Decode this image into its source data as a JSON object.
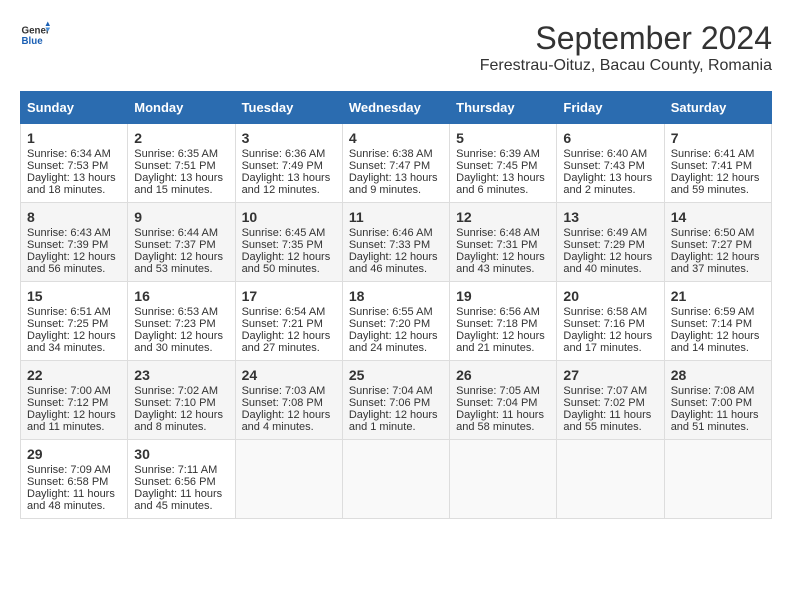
{
  "header": {
    "logo_general": "General",
    "logo_blue": "Blue",
    "month_title": "September 2024",
    "location": "Ferestrau-Oituz, Bacau County, Romania"
  },
  "columns": [
    "Sunday",
    "Monday",
    "Tuesday",
    "Wednesday",
    "Thursday",
    "Friday",
    "Saturday"
  ],
  "weeks": [
    [
      {
        "day": "1",
        "sunrise": "6:34 AM",
        "sunset": "7:53 PM",
        "daylight": "13 hours and 18 minutes."
      },
      {
        "day": "2",
        "sunrise": "6:35 AM",
        "sunset": "7:51 PM",
        "daylight": "13 hours and 15 minutes."
      },
      {
        "day": "3",
        "sunrise": "6:36 AM",
        "sunset": "7:49 PM",
        "daylight": "13 hours and 12 minutes."
      },
      {
        "day": "4",
        "sunrise": "6:38 AM",
        "sunset": "7:47 PM",
        "daylight": "13 hours and 9 minutes."
      },
      {
        "day": "5",
        "sunrise": "6:39 AM",
        "sunset": "7:45 PM",
        "daylight": "13 hours and 6 minutes."
      },
      {
        "day": "6",
        "sunrise": "6:40 AM",
        "sunset": "7:43 PM",
        "daylight": "13 hours and 2 minutes."
      },
      {
        "day": "7",
        "sunrise": "6:41 AM",
        "sunset": "7:41 PM",
        "daylight": "12 hours and 59 minutes."
      }
    ],
    [
      {
        "day": "8",
        "sunrise": "6:43 AM",
        "sunset": "7:39 PM",
        "daylight": "12 hours and 56 minutes."
      },
      {
        "day": "9",
        "sunrise": "6:44 AM",
        "sunset": "7:37 PM",
        "daylight": "12 hours and 53 minutes."
      },
      {
        "day": "10",
        "sunrise": "6:45 AM",
        "sunset": "7:35 PM",
        "daylight": "12 hours and 50 minutes."
      },
      {
        "day": "11",
        "sunrise": "6:46 AM",
        "sunset": "7:33 PM",
        "daylight": "12 hours and 46 minutes."
      },
      {
        "day": "12",
        "sunrise": "6:48 AM",
        "sunset": "7:31 PM",
        "daylight": "12 hours and 43 minutes."
      },
      {
        "day": "13",
        "sunrise": "6:49 AM",
        "sunset": "7:29 PM",
        "daylight": "12 hours and 40 minutes."
      },
      {
        "day": "14",
        "sunrise": "6:50 AM",
        "sunset": "7:27 PM",
        "daylight": "12 hours and 37 minutes."
      }
    ],
    [
      {
        "day": "15",
        "sunrise": "6:51 AM",
        "sunset": "7:25 PM",
        "daylight": "12 hours and 34 minutes."
      },
      {
        "day": "16",
        "sunrise": "6:53 AM",
        "sunset": "7:23 PM",
        "daylight": "12 hours and 30 minutes."
      },
      {
        "day": "17",
        "sunrise": "6:54 AM",
        "sunset": "7:21 PM",
        "daylight": "12 hours and 27 minutes."
      },
      {
        "day": "18",
        "sunrise": "6:55 AM",
        "sunset": "7:20 PM",
        "daylight": "12 hours and 24 minutes."
      },
      {
        "day": "19",
        "sunrise": "6:56 AM",
        "sunset": "7:18 PM",
        "daylight": "12 hours and 21 minutes."
      },
      {
        "day": "20",
        "sunrise": "6:58 AM",
        "sunset": "7:16 PM",
        "daylight": "12 hours and 17 minutes."
      },
      {
        "day": "21",
        "sunrise": "6:59 AM",
        "sunset": "7:14 PM",
        "daylight": "12 hours and 14 minutes."
      }
    ],
    [
      {
        "day": "22",
        "sunrise": "7:00 AM",
        "sunset": "7:12 PM",
        "daylight": "12 hours and 11 minutes."
      },
      {
        "day": "23",
        "sunrise": "7:02 AM",
        "sunset": "7:10 PM",
        "daylight": "12 hours and 8 minutes."
      },
      {
        "day": "24",
        "sunrise": "7:03 AM",
        "sunset": "7:08 PM",
        "daylight": "12 hours and 4 minutes."
      },
      {
        "day": "25",
        "sunrise": "7:04 AM",
        "sunset": "7:06 PM",
        "daylight": "12 hours and 1 minute."
      },
      {
        "day": "26",
        "sunrise": "7:05 AM",
        "sunset": "7:04 PM",
        "daylight": "11 hours and 58 minutes."
      },
      {
        "day": "27",
        "sunrise": "7:07 AM",
        "sunset": "7:02 PM",
        "daylight": "11 hours and 55 minutes."
      },
      {
        "day": "28",
        "sunrise": "7:08 AM",
        "sunset": "7:00 PM",
        "daylight": "11 hours and 51 minutes."
      }
    ],
    [
      {
        "day": "29",
        "sunrise": "7:09 AM",
        "sunset": "6:58 PM",
        "daylight": "11 hours and 48 minutes."
      },
      {
        "day": "30",
        "sunrise": "7:11 AM",
        "sunset": "6:56 PM",
        "daylight": "11 hours and 45 minutes."
      },
      null,
      null,
      null,
      null,
      null
    ]
  ]
}
